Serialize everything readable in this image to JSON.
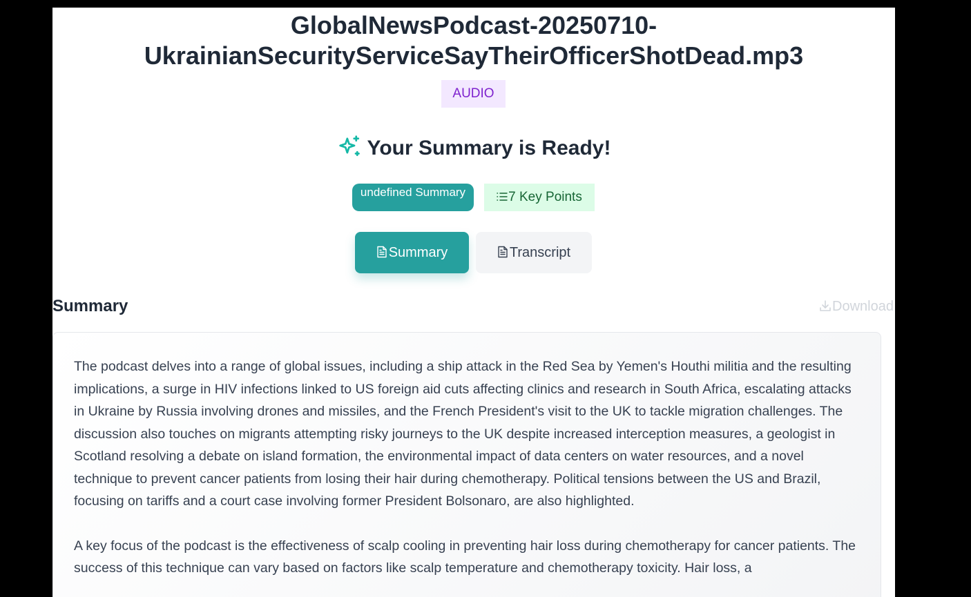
{
  "file": {
    "title_line1": "GlobalNewsPodcast-20250710-",
    "title_line2": "UkrainianSecurityServiceSayTheirOfficerShotDead.mp3",
    "type_badge": "AUDIO"
  },
  "result": {
    "heading": "Your Summary is Ready!",
    "heading_icon": "sparkles-icon",
    "summary_type_badge": "undefined Summary",
    "key_points_badge": "7 Key Points",
    "key_points_icon": "list-icon"
  },
  "tabs": [
    {
      "label": "Summary",
      "icon": "document-icon",
      "active": true
    },
    {
      "label": "Transcript",
      "icon": "document-icon",
      "active": false
    }
  ],
  "summary_section": {
    "heading": "Summary",
    "download_label": "Download",
    "download_icon": "download-icon",
    "paragraphs": [
      "The podcast delves into a range of global issues, including a ship attack in the Red Sea by Yemen's Houthi militia and the resulting implications, a surge in HIV infections linked to US foreign aid cuts affecting clinics and research in South Africa, escalating attacks in Ukraine by Russia involving drones and missiles, and the French President's visit to the UK to tackle migration challenges. The discussion also touches on migrants attempting risky journeys to the UK despite increased interception measures, a geologist in Scotland resolving a debate on island formation, the environmental impact of data centers on water resources, and a novel technique to prevent cancer patients from losing their hair during chemotherapy. Political tensions between the US and Brazil, focusing on tariffs and a court case involving former President Bolsonaro, are also highlighted.",
      "A key focus of the podcast is the effectiveness of scalp cooling in preventing hair loss during chemotherapy for cancer patients. The success of this technique can vary based on factors like scalp temperature and chemotherapy toxicity. Hair loss, a"
    ]
  },
  "colors": {
    "accent": "#26a09e",
    "type_badge_bg": "#f3e8ff",
    "type_badge_text": "#7e22ce",
    "key_points_bg": "#dcfce7",
    "key_points_text": "#166534"
  }
}
